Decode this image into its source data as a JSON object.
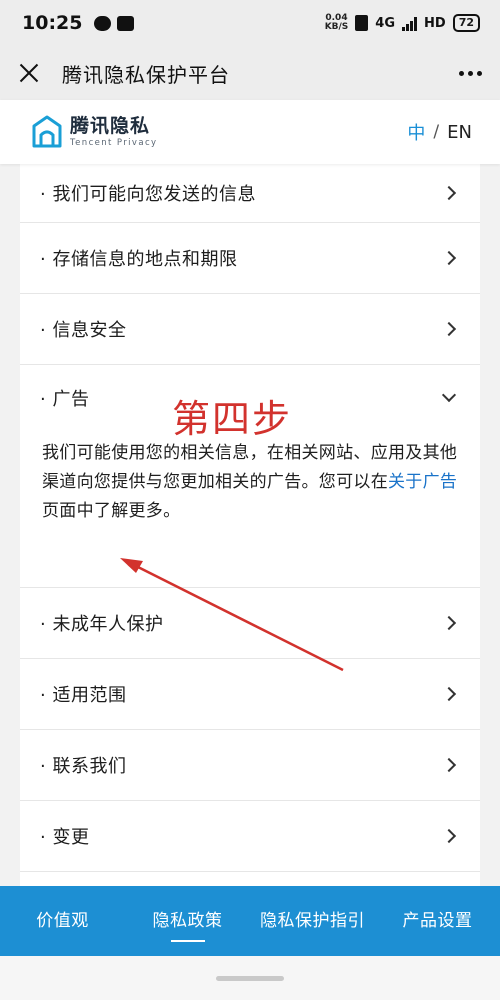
{
  "status_bar": {
    "time": "10:25",
    "net_speed_value": "0.04",
    "net_speed_unit": "KB/S",
    "network_type": "4G",
    "hd_label": "HD",
    "battery": "72"
  },
  "header": {
    "title": "腾讯隐私保护平台"
  },
  "site": {
    "logo_cn": "腾讯隐私",
    "logo_en": "Tencent Privacy",
    "lang_zh": "中",
    "lang_sep": "/",
    "lang_en": "EN",
    "accent": "#1a8fd6"
  },
  "sections": [
    {
      "label": "· 我们可能向您发送的信息",
      "state": "collapsed"
    },
    {
      "label": "· 存储信息的地点和期限",
      "state": "collapsed"
    },
    {
      "label": "· 信息安全",
      "state": "collapsed"
    },
    {
      "label": "· 广告",
      "state": "expanded"
    },
    {
      "label": "· 未成年人保护",
      "state": "collapsed"
    },
    {
      "label": "· 适用范围",
      "state": "collapsed"
    },
    {
      "label": "· 联系我们",
      "state": "collapsed"
    },
    {
      "label": "· 变更",
      "state": "collapsed"
    }
  ],
  "ad_body": {
    "text_before": "我们可能使用您的相关信息，在相关网站、应用及其他渠道向您提供与您更加相关的广告。您可以在",
    "link": "关于广告",
    "text_after": "页面中了解更多。"
  },
  "annotation": {
    "text": "第四步",
    "color": "#d2322d"
  },
  "bottom_nav": {
    "items": [
      "价值观",
      "隐私政策",
      "隐私保护指引",
      "产品设置"
    ],
    "active_index": 1,
    "color": "#1d8fd3"
  }
}
